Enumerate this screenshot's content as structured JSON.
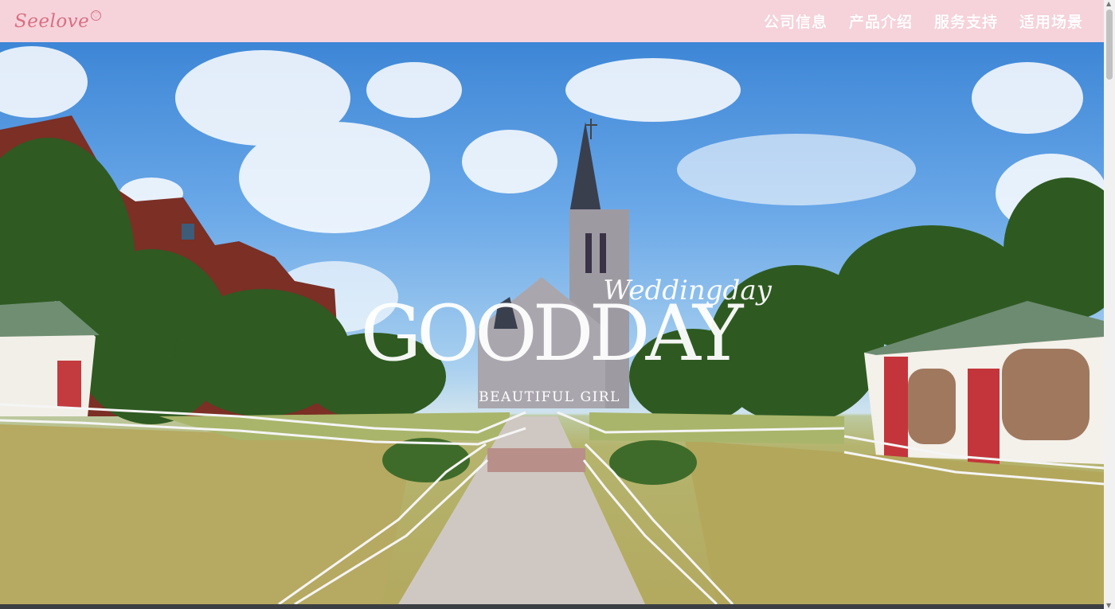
{
  "brand": {
    "logo_text": "Seelove"
  },
  "nav": {
    "items": [
      {
        "label": "公司信息"
      },
      {
        "label": "产品介绍"
      },
      {
        "label": "服务支持"
      },
      {
        "label": "适用场景"
      }
    ]
  },
  "hero": {
    "script_text": "Weddingday",
    "title": "GOODDAY",
    "subtitle": "BEAUTIFUL GIRL",
    "image": "church-garden-panorama"
  },
  "colors": {
    "topbar": "#f6d3db",
    "logo": "#d86f82",
    "nav_text": "#ffffff"
  }
}
